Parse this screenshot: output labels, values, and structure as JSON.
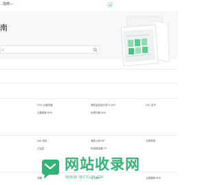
{
  "topbar": {
    "title": "...指南",
    "badge": "v2"
  },
  "hero": {
    "title": "南",
    "search_placeholder": "词"
  },
  "rows": [
    [
      "GPU 云服务器",
      "弹性高性能计算 E-HPC",
      "SSL 证书"
    ],
    [
      "云数据库 RDS",
      "负载均衡 SLB"
    ],
    [
      "NAT 网关",
      "弹性公网 EIP",
      "共享带宽"
    ],
    [
      "云监控",
      "转发路由器 TR"
    ],
    [
      "务器",
      "云上移行",
      "云数据库 RDS"
    ]
  ],
  "watermark": {
    "text": "网站收录网",
    "url": "WWW.WZSLW.CN",
    "brand_color": "#2eb573"
  },
  "icons": {
    "search": "search-icon",
    "logo": "logo-icon",
    "illustration": "server-illustration",
    "watermark": "chat-bubble-icon"
  }
}
